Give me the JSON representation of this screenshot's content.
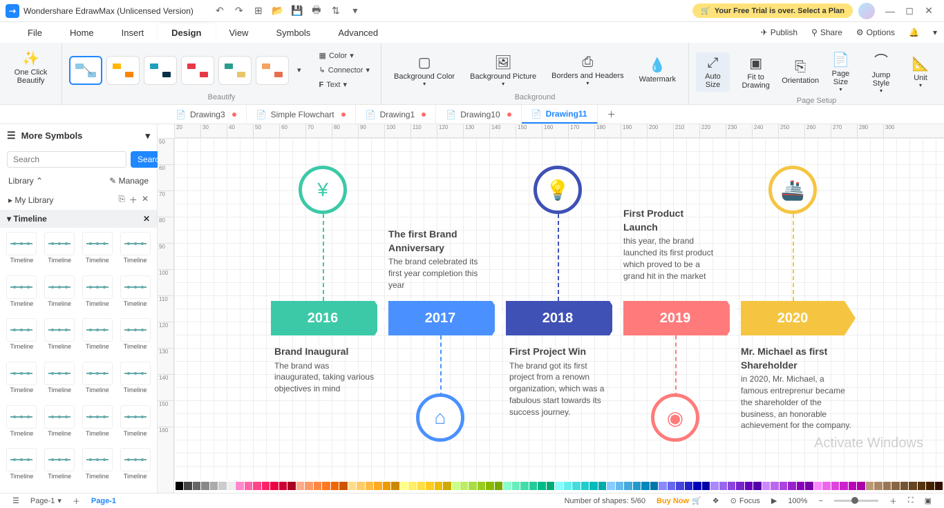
{
  "app_title": "Wondershare EdrawMax (Unlicensed Version)",
  "trial_notice": "Your Free Trial is over. Select a Plan",
  "menu": {
    "file": "File",
    "home": "Home",
    "insert": "Insert",
    "design": "Design",
    "view": "View",
    "symbols": "Symbols",
    "advanced": "Advanced",
    "publish": "Publish",
    "share": "Share",
    "options": "Options"
  },
  "ribbon": {
    "beautify": "One Click\nBeautify",
    "color": "Color",
    "connector": "Connector",
    "text": "Text",
    "beautify_label": "Beautify",
    "bg_color": "Background Color",
    "bg_pic": "Background Picture",
    "borders": "Borders and Headers",
    "watermark": "Watermark",
    "bg_label": "Background",
    "auto": "Auto Size",
    "fit": "Fit to Drawing",
    "orient": "Orientation",
    "psize": "Page Size",
    "jstyle": "Jump Style",
    "unit": "Unit",
    "ps_label": "Page Setup"
  },
  "tabs": [
    {
      "label": "Drawing3",
      "dot": true
    },
    {
      "label": "Simple Flowchart",
      "dot": true
    },
    {
      "label": "Drawing1",
      "dot": true
    },
    {
      "label": "Drawing10",
      "dot": true
    },
    {
      "label": "Drawing11",
      "dot": false,
      "active": true
    }
  ],
  "left": {
    "more": "More Symbols",
    "search_ph": "Search",
    "search_btn": "Search",
    "library": "Library",
    "manage": "Manage",
    "mylib": "My Library",
    "timeline": "Timeline",
    "item_label": "Timeline"
  },
  "ruler_h": [
    "20",
    "30",
    "40",
    "50",
    "60",
    "70",
    "80",
    "90",
    "100",
    "110",
    "120",
    "130",
    "140",
    "150",
    "160",
    "170",
    "180",
    "190",
    "200",
    "210",
    "220",
    "230",
    "240",
    "250",
    "260",
    "270",
    "280",
    "300"
  ],
  "ruler_v": [
    "50",
    "60",
    "70",
    "80",
    "90",
    "100",
    "110",
    "120",
    "130",
    "140",
    "150",
    "160"
  ],
  "timeline": {
    "y2016": {
      "year": "2016",
      "title": "Brand Inaugural",
      "body": "The brand was inaugurated, taking various objectives in mind"
    },
    "y2017": {
      "year": "2017",
      "title": "The first Brand Anniversary",
      "body": "The brand celebrated its first year completion this year"
    },
    "y2018": {
      "year": "2018",
      "title": "First Project Win",
      "body": "The brand got its first project from a renown organization, which was a fabulous start towards its success journey."
    },
    "y2019": {
      "year": "2019",
      "title": "First Product Launch",
      "body": "this year, the brand launched its first product which proved to be a grand hit in the market"
    },
    "y2020": {
      "year": "2020",
      "title": "Mr. Michael as first Shareholder",
      "body": "in 2020, Mr. Michael, a famous entreprenur became the shareholder of the business, an honorable achievement for the company."
    }
  },
  "palette": [
    "#000",
    "#444",
    "#666",
    "#888",
    "#aaa",
    "#ccc",
    "#eee",
    "#f8c",
    "#f6a",
    "#f48",
    "#f26",
    "#e04",
    "#c03",
    "#a02",
    "#fa8",
    "#f96",
    "#f84",
    "#f72",
    "#e60",
    "#c50",
    "#fd8",
    "#fc6",
    "#fb4",
    "#fa2",
    "#e90",
    "#c80",
    "#ff8",
    "#fe6",
    "#fd4",
    "#fc2",
    "#eb0",
    "#ca0",
    "#cf8",
    "#be6",
    "#ad4",
    "#9c2",
    "#8b0",
    "#7a0",
    "#8fc",
    "#6eb",
    "#4da",
    "#2c9",
    "#0b8",
    "#0a7",
    "#8ff",
    "#6ee",
    "#4dd",
    "#2cc",
    "#0bb",
    "#0aa",
    "#8cf",
    "#6be",
    "#4ad",
    "#29c",
    "#08b",
    "#07a",
    "#88f",
    "#66e",
    "#44d",
    "#22c",
    "#00b",
    "#00a",
    "#a8f",
    "#96e",
    "#84d",
    "#72c",
    "#60b",
    "#50a",
    "#c8f",
    "#b6e",
    "#a4d",
    "#92c",
    "#80b",
    "#70a",
    "#f8f",
    "#e6e",
    "#d4d",
    "#c2c",
    "#b0b",
    "#a0a",
    "#b97",
    "#a86",
    "#975",
    "#864",
    "#753",
    "#642",
    "#531",
    "#420",
    "#310"
  ],
  "status": {
    "page": "Page-1",
    "page_sel": "Page-1",
    "shapes": "Number of shapes: 5/60",
    "buy": "Buy Now",
    "focus": "Focus",
    "zoom": "100%"
  },
  "watermark": "Activate Windows"
}
